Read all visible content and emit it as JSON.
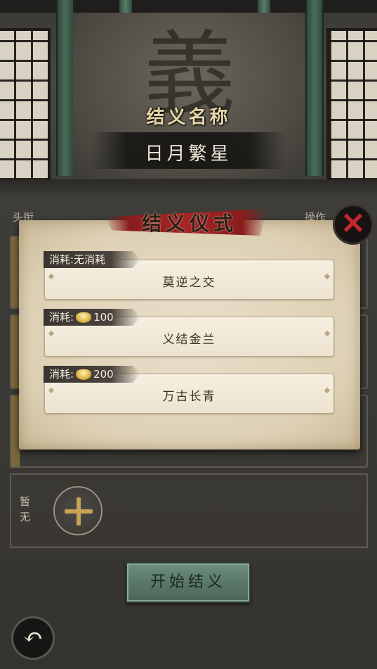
{
  "header": {
    "section_label": "结义名称",
    "brotherhood_name": "日月繁星",
    "background_glyph": "義"
  },
  "list": {
    "col_left": "头衔",
    "col_right": "操作",
    "empty_label": "暂无",
    "add_icon": "plus-icon"
  },
  "start_button": "开始结义",
  "back_icon": "back-arrow-icon",
  "dialog": {
    "title": "结义仪式",
    "close_icon": "close-x-icon",
    "options": [
      {
        "cost_prefix": "消耗:",
        "cost_text": "无消耗",
        "has_ingot": false,
        "amount": "",
        "label": "莫逆之交"
      },
      {
        "cost_prefix": "消耗:",
        "cost_text": "",
        "has_ingot": true,
        "amount": "100",
        "label": "义结金兰"
      },
      {
        "cost_prefix": "消耗:",
        "cost_text": "",
        "has_ingot": true,
        "amount": "200",
        "label": "万古长青"
      }
    ]
  },
  "colors": {
    "close_x": "#c4272b",
    "ribbon": "#a62525",
    "start_button": "#5a7869",
    "ingot": "#e2b84a"
  }
}
